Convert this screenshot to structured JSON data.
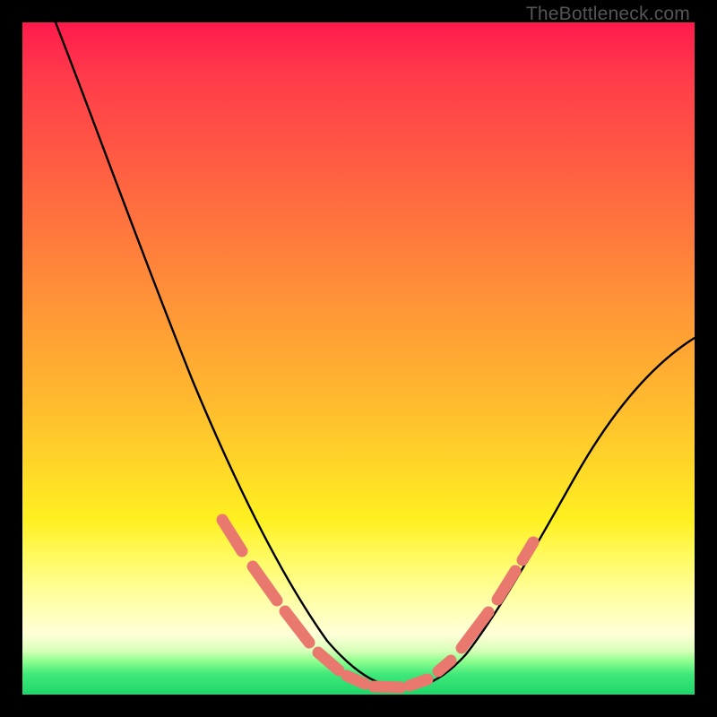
{
  "watermark": "TheBottleneck.com",
  "chart_data": {
    "type": "line",
    "title": "",
    "xlabel": "",
    "ylabel": "",
    "xlim": [
      0,
      100
    ],
    "ylim": [
      0,
      100
    ],
    "series": [
      {
        "name": "curve",
        "x": [
          5,
          10,
          15,
          20,
          25,
          30,
          35,
          40,
          45,
          48,
          52,
          56,
          60,
          65,
          70,
          75,
          80,
          85,
          90,
          95,
          100
        ],
        "y": [
          100,
          89,
          78,
          67,
          56,
          45,
          34,
          23,
          12,
          6,
          2,
          1,
          1,
          4,
          10,
          18,
          26,
          34,
          42,
          48,
          53
        ]
      }
    ],
    "highlight_segments": [
      {
        "x": [
          30,
          33
        ],
        "y": [
          27,
          23
        ]
      },
      {
        "x": [
          34.5,
          38
        ],
        "y": [
          20.5,
          15
        ]
      },
      {
        "x": [
          39,
          42.5
        ],
        "y": [
          13.5,
          8
        ]
      },
      {
        "x": [
          44,
          47
        ],
        "y": [
          6,
          3.5
        ]
      },
      {
        "x": [
          48,
          50.5
        ],
        "y": [
          3,
          2
        ]
      },
      {
        "x": [
          52,
          56
        ],
        "y": [
          1.5,
          1.5
        ]
      },
      {
        "x": [
          57.5,
          60
        ],
        "y": [
          2,
          3
        ]
      },
      {
        "x": [
          62,
          63.5
        ],
        "y": [
          5,
          7
        ]
      },
      {
        "x": [
          65,
          69
        ],
        "y": [
          9,
          15
        ]
      },
      {
        "x": [
          70.5,
          73
        ],
        "y": [
          18,
          23
        ]
      },
      {
        "x": [
          74,
          75.5
        ],
        "y": [
          25,
          28
        ]
      }
    ],
    "colors": {
      "curve": "#000000",
      "highlight": "#e9786f",
      "gradient_top": "#ff1a4d",
      "gradient_mid": "#ffd728",
      "gradient_bottom": "#1fd66a"
    }
  }
}
